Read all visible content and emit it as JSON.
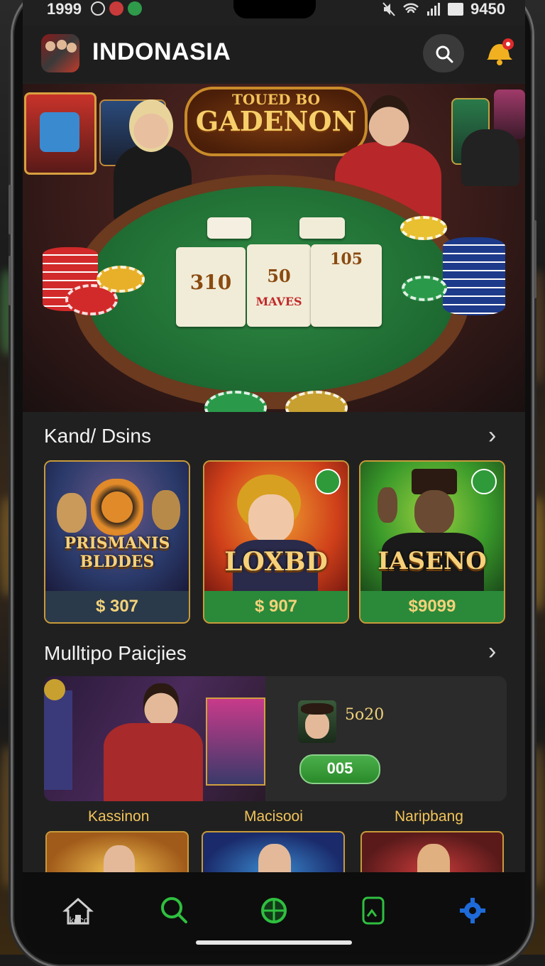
{
  "status_bar": {
    "time": "1999",
    "right_text": "9450"
  },
  "app_bar": {
    "title": "INDONASIA"
  },
  "hero": {
    "sign_top": "TOUED BO",
    "sign_main": "GADENON",
    "cards": [
      "310",
      "50",
      "MAVES",
      "105"
    ]
  },
  "section_1": {
    "title": "Kand/ Dsins",
    "games": [
      {
        "name": "PRISMANIS BLDDES",
        "price": "$ 307"
      },
      {
        "name": "LOXBD",
        "price": "$ 907"
      },
      {
        "name": "IASENO",
        "price": "$9099"
      }
    ]
  },
  "section_2": {
    "title": "Mulltipo Paicjies",
    "value": "5o20",
    "button_label": "005",
    "categories": [
      "Kassinon",
      "Macisooi",
      "Naripbang"
    ]
  },
  "bottom_nav": {
    "home_label": "Ikeco"
  }
}
